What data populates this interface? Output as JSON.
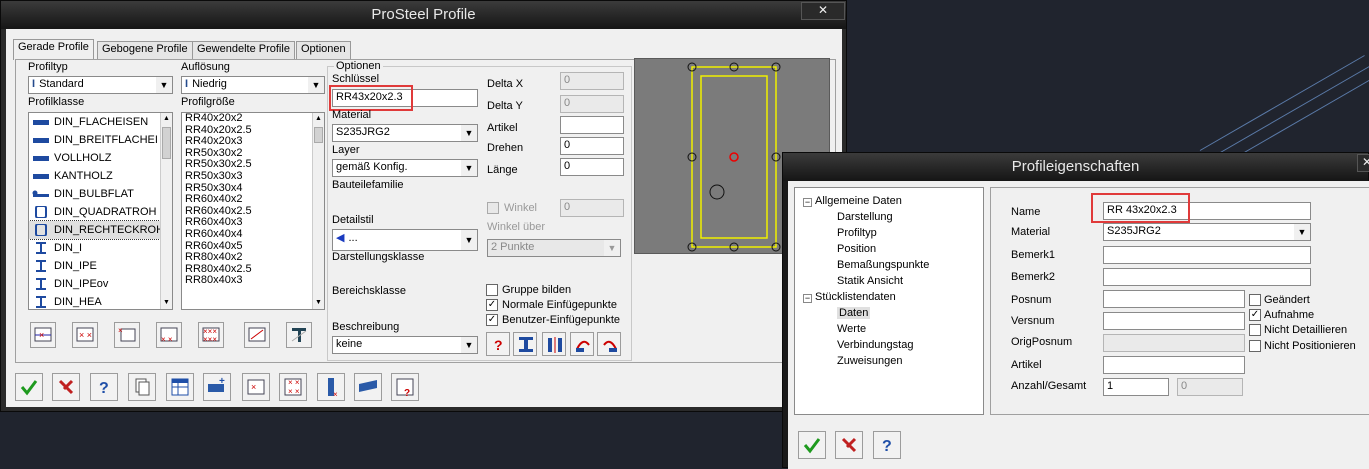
{
  "main_window": {
    "title": "ProSteel Profile",
    "close_glyph": "✕",
    "tabs": [
      "Gerade Profile",
      "Gebogene Profile",
      "Gewendelte Profile",
      "Optionen"
    ],
    "profiltyp_label": "Profiltyp",
    "profiltyp_value": "Standard",
    "aufloesung_label": "Auflösung",
    "aufloesung_value": "Niedrig",
    "profilklasse_label": "Profilklasse",
    "profilklasse_items": [
      "DIN_FLACHEISEN",
      "DIN_BREITFLACHEI",
      "VOLLHOLZ",
      "KANTHOLZ",
      "DIN_BULBFLAT",
      "DIN_QUADRATROH",
      "DIN_RECHTECKROH",
      "DIN_I",
      "DIN_IPE",
      "DIN_IPEov",
      "DIN_HEA"
    ],
    "profilgroesse_label": "Profilgröße",
    "profilgroesse_items": [
      "RR40x20x2",
      "RR40x20x2.5",
      "RR40x20x3",
      "RR50x30x2",
      "RR50x30x2.5",
      "RR50x30x3",
      "RR50x30x4",
      "RR60x40x2",
      "RR60x40x2.5",
      "RR60x40x3",
      "RR60x40x4",
      "RR60x40x5",
      "RR80x40x2",
      "RR80x40x2.5",
      "RR80x40x3"
    ],
    "optionen_label": "Optionen",
    "schluessel_label": "Schlüssel",
    "schluessel_value": "RR43x20x2.3",
    "material_label": "Material",
    "material_value": "S235JRG2",
    "layer_label": "Layer",
    "layer_value": "gemäß Konfig.",
    "bauteilefamilie_label": "Bauteilefamilie",
    "detailstil_label": "Detailstil",
    "detailstil_value": "...",
    "darstellungsklasse_label": "Darstellungsklasse",
    "bereichsklasse_label": "Bereichsklasse",
    "beschreibung_label": "Beschreibung",
    "beschreibung_value": "keine",
    "delta_x_label": "Delta X",
    "delta_x_value": "0",
    "delta_y_label": "Delta Y",
    "delta_y_value": "0",
    "artikel_label": "Artikel",
    "artikel_value": "",
    "drehen_label": "Drehen",
    "drehen_value": "0",
    "laenge_label": "Länge",
    "laenge_value": "0",
    "winkel_label": "Winkel",
    "winkel_value": "0",
    "winkel_ueber_label": "Winkel über",
    "winkel_ueber_value": "2 Punkte",
    "gruppe_bilden_label": "Gruppe bilden",
    "normale_einfuege_label": "Normale Einfügepunkte",
    "benutzer_einfuege_label": "Benutzer-Einfügepunkte",
    "checks": {
      "gruppe_bilden": false,
      "normale": true,
      "benutzer": true
    }
  },
  "props_window": {
    "title": "Profileigenschaften",
    "close_glyph": "✕",
    "tree": {
      "allgemeine_daten": "Allgemeine Daten",
      "allgemeine_children": [
        "Darstellung",
        "Profiltyp",
        "Position",
        "Bemaßungspunkte",
        "Statik Ansicht"
      ],
      "stuecklistendaten": "Stücklistendaten",
      "stueckliste_children": [
        "Daten",
        "Werte",
        "Verbindungstag",
        "Zuweisungen"
      ]
    },
    "name_label": "Name",
    "name_value": "RR 43x20x2.3",
    "material_label": "Material",
    "material_value": "S235JRG2",
    "bemerk1_label": "Bemerk1",
    "bemerk2_label": "Bemerk2",
    "posnum_label": "Posnum",
    "versnum_label": "Versnum",
    "origposnum_label": "OrigPosnum",
    "artikel_label": "Artikel",
    "anzahl_label": "Anzahl/Gesamt",
    "anzahl_value": "1",
    "gesamt_value": "0",
    "geaendert_label": "Geändert",
    "aufnahme_label": "Aufnahme",
    "nicht_detaillieren_label": "Nicht Detaillieren",
    "nicht_positionieren_label": "Nicht Positionieren",
    "checks": {
      "geaendert": false,
      "aufnahme": true,
      "nicht_detaillieren": false,
      "nicht_positionieren": false
    }
  },
  "colors": {
    "highlight": "#e03a3a",
    "accept": "#1e9a1e",
    "cancel": "#c02020",
    "help": "#1f4fa8"
  }
}
